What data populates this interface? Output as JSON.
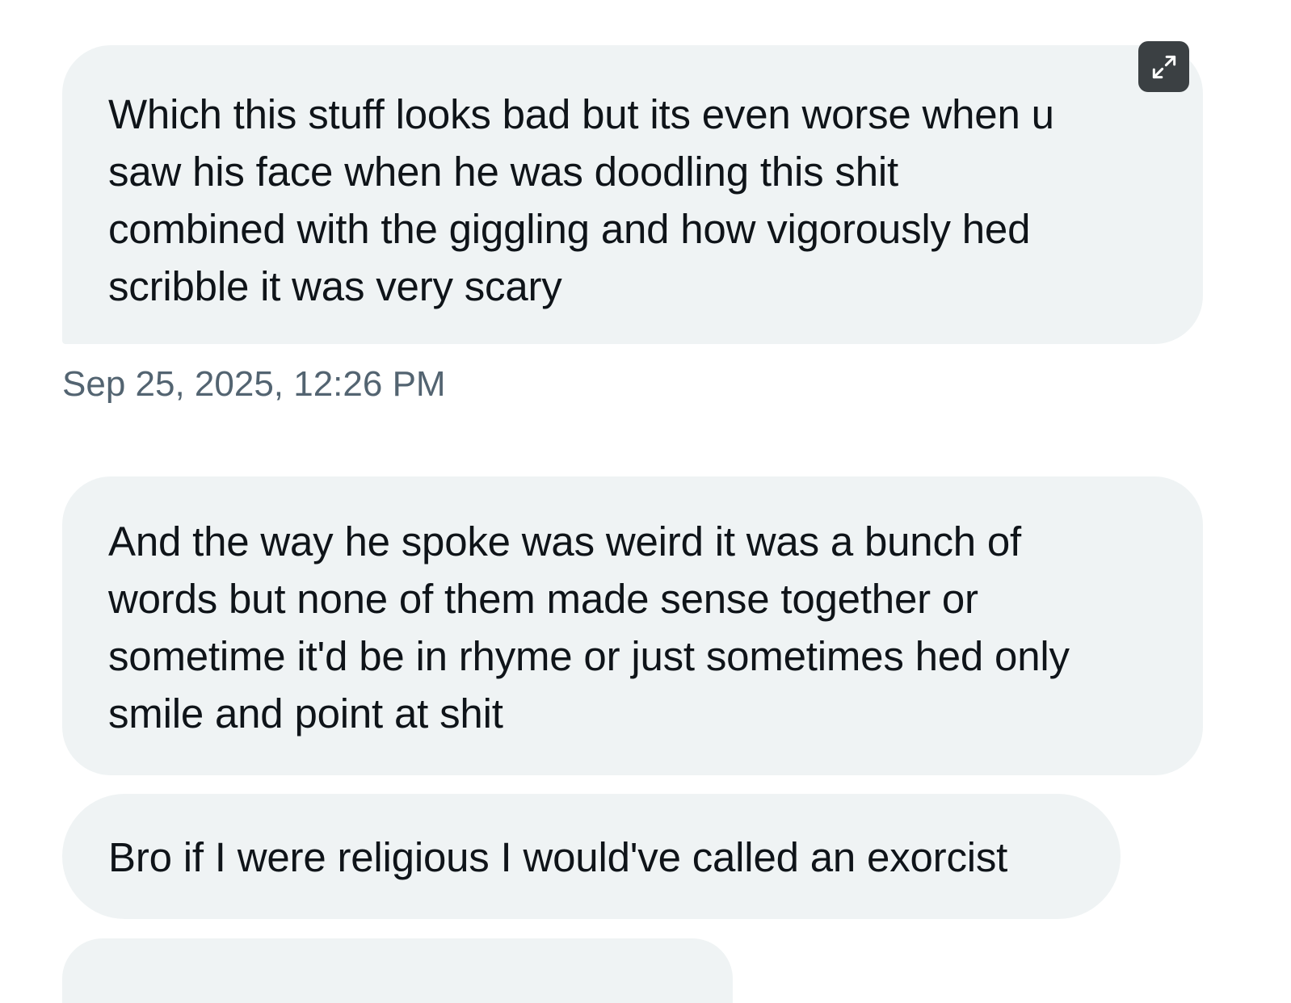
{
  "conversation": {
    "messages": [
      {
        "text": "Which this stuff looks bad but its even worse when u\nsaw his face when he was doodling this shit\ncombined with the giggling and how vigorously hed\nscribble it was very scary"
      },
      {
        "text": "And the way he spoke was weird it was a bunch of\nwords but none of them made sense together or\nsometime it'd be in rhyme or just sometimes hed only\nsmile and point at shit"
      },
      {
        "text": "Bro if I were religious I would've called an exorcist"
      }
    ],
    "timestamp": "Sep 25, 2025, 12:26 PM"
  },
  "icons": {
    "expand": "expand-arrows-icon"
  },
  "colors": {
    "bubble_background": "#eff3f4",
    "message_text": "#0f1419",
    "timestamp_text": "#536471",
    "expand_button_background": "#3b4043"
  }
}
